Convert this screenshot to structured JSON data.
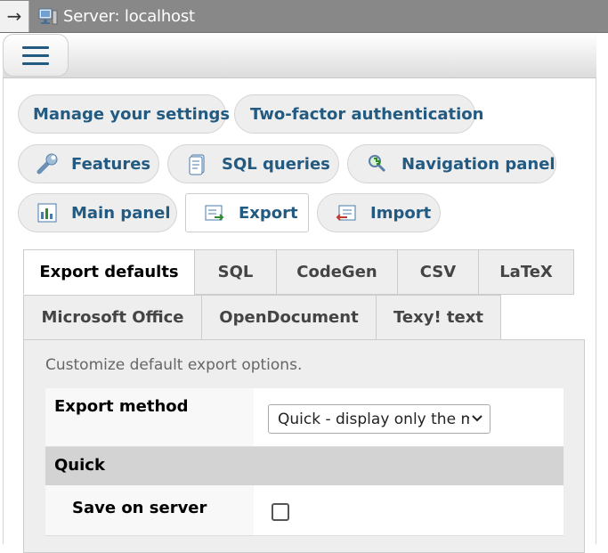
{
  "topbar": {
    "arrow": "→",
    "title": "Server: localhost"
  },
  "settings_nav": [
    {
      "label": "Manage your settings",
      "icon": ""
    },
    {
      "label": "Two-factor authentication",
      "icon": ""
    },
    {
      "label": "Features",
      "icon": "wrench-icon"
    },
    {
      "label": "SQL queries",
      "icon": "sql-document-icon"
    },
    {
      "label": "Navigation panel",
      "icon": "navigation-magnifier-icon"
    },
    {
      "label": "Main panel",
      "icon": "main-panel-chart-icon"
    },
    {
      "label": "Export",
      "icon": "export-icon",
      "active": true
    },
    {
      "label": "Import",
      "icon": "import-icon"
    }
  ],
  "tabs": [
    {
      "label": "Export defaults",
      "active": true
    },
    {
      "label": "SQL"
    },
    {
      "label": "CodeGen"
    },
    {
      "label": "CSV"
    },
    {
      "label": "LaTeX"
    },
    {
      "label": "Microsoft Office"
    },
    {
      "label": "OpenDocument"
    },
    {
      "label": "Texy! text"
    }
  ],
  "panel": {
    "description": "Customize default export options.",
    "export_method_label": "Export method",
    "export_method_value": "Quick - display only the minimal options",
    "section_quick": "Quick",
    "save_on_server_label": "Save on server",
    "save_on_server_checked": false
  },
  "colors": {
    "link": "#235a81",
    "topbar": "#888888",
    "section": "#d3d3d3"
  }
}
